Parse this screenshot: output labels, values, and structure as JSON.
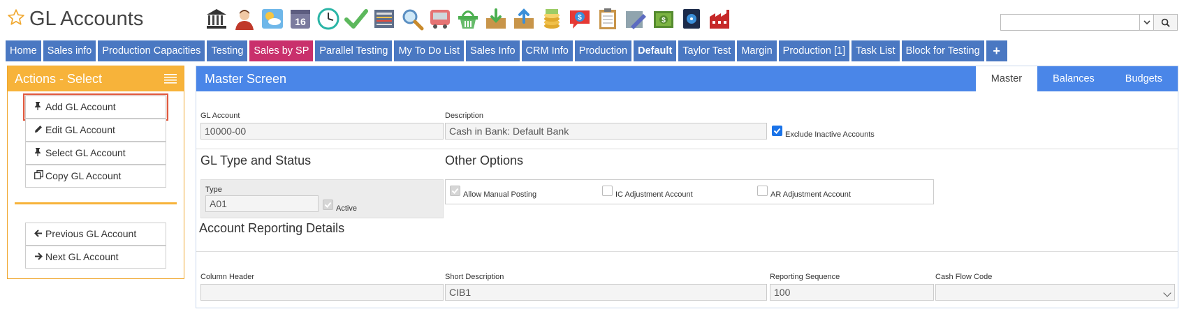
{
  "header": {
    "title": "GL Accounts",
    "toolbar_icons": [
      "bank-icon",
      "user-icon",
      "weather-icon",
      "calendar-icon",
      "clock-icon",
      "checkmark-icon",
      "news-icon",
      "magnifier-icon",
      "truck-icon",
      "basket-icon",
      "inbox-icon",
      "outbox-icon",
      "coins-icon",
      "chat-dollar-icon",
      "clipboard-icon",
      "pencil-icon",
      "money-icon",
      "safe-icon",
      "factory-icon"
    ],
    "calendar_day": "16",
    "search": {
      "value": ""
    }
  },
  "tabs": [
    {
      "label": "Home",
      "style": "normal"
    },
    {
      "label": "Sales info",
      "style": "normal"
    },
    {
      "label": "Production Capacities",
      "style": "normal"
    },
    {
      "label": "Testing",
      "style": "normal"
    },
    {
      "label": "Sales by SP",
      "style": "pink"
    },
    {
      "label": "Parallel Testing",
      "style": "normal"
    },
    {
      "label": "My To Do List",
      "style": "normal"
    },
    {
      "label": "Sales Info",
      "style": "normal"
    },
    {
      "label": "CRM Info",
      "style": "normal"
    },
    {
      "label": "Production",
      "style": "normal"
    },
    {
      "label": "Default",
      "style": "bold"
    },
    {
      "label": "Taylor Test",
      "style": "normal"
    },
    {
      "label": "Margin",
      "style": "normal"
    },
    {
      "label": "Production [1]",
      "style": "normal"
    },
    {
      "label": "Task List",
      "style": "normal"
    },
    {
      "label": "Block for Testing",
      "style": "normal"
    },
    {
      "label": "+",
      "style": "plus"
    }
  ],
  "actions": {
    "title": "Actions - Select",
    "items": [
      {
        "label": "Add GL Account",
        "icon": "pin-icon"
      },
      {
        "label": "Edit GL Account",
        "icon": "pencil-icon"
      },
      {
        "label": "Select GL Account",
        "icon": "pin-icon"
      },
      {
        "label": "Copy GL Account",
        "icon": "copy-icon"
      }
    ],
    "nav": [
      {
        "label": "Previous GL Account",
        "icon": "arrow-left-icon"
      },
      {
        "label": "Next GL Account",
        "icon": "arrow-right-icon"
      }
    ]
  },
  "master": {
    "title": "Master Screen",
    "tabs": [
      "Master",
      "Balances",
      "Budgets"
    ],
    "active_tab": "Master",
    "gl_account": {
      "label": "GL Account",
      "value": "10000-00"
    },
    "description": {
      "label": "Description",
      "value": "Cash in Bank: Default Bank"
    },
    "exclude_inactive": {
      "label": "Exclude Inactive Accounts",
      "checked": true
    },
    "type_status": {
      "heading": "GL Type and Status",
      "type_label": "Type",
      "type_value": "A01",
      "active_label": "Active",
      "active_checked": true
    },
    "other_options": {
      "heading": "Other Options",
      "manual_posting": {
        "label": "Allow Manual Posting",
        "checked": true
      },
      "ic_adjustment": {
        "label": "IC Adjustment Account",
        "checked": false
      },
      "ar_adjustment": {
        "label": "AR Adjustment Account",
        "checked": false
      }
    },
    "reporting": {
      "heading": "Account Reporting Details",
      "column_header": {
        "label": "Column Header",
        "value": ""
      },
      "short_description": {
        "label": "Short Description",
        "value": "CIB1"
      },
      "reporting_sequence": {
        "label": "Reporting Sequence",
        "value": "100"
      },
      "cash_flow_code": {
        "label": "Cash Flow Code",
        "value": ""
      }
    }
  },
  "colors": {
    "tab_blue": "#4a78c2",
    "tab_pink": "#c9306c",
    "actions_orange": "#f7b33a",
    "master_blue": "#4a86e8",
    "highlight_red": "#e05a3f"
  }
}
